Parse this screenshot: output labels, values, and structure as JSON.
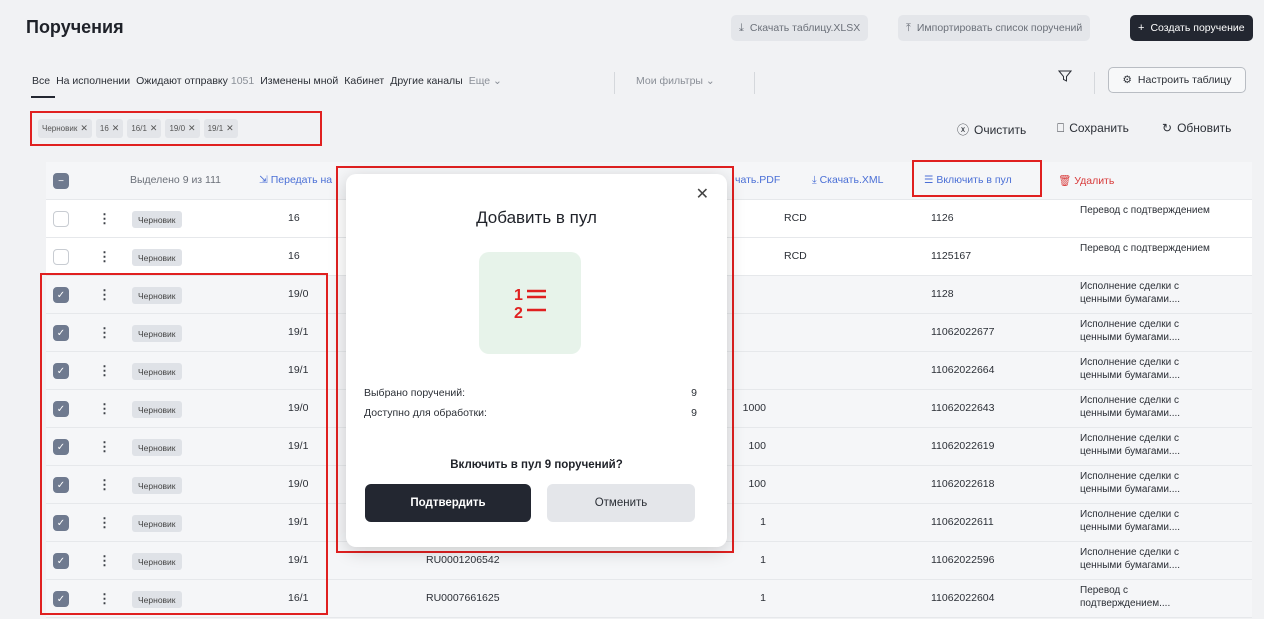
{
  "header": {
    "title": "Поручения",
    "download_xlsx": "Скачать таблицу.XLSX",
    "import_list": "Импортировать список поручений",
    "create_order": "Создать поручение"
  },
  "tabs": {
    "all": "Все",
    "in_progress": "На исполнении",
    "awaiting": "Ожидают отправку",
    "awaiting_count": "1051",
    "changed_by_me": "Изменены мной",
    "cabinet": "Кабинет",
    "other_channels": "Другие каналы",
    "more": "Еще",
    "my_filters": "Мои фильтры",
    "configure_table": "Настроить таблицу"
  },
  "chips": [
    "Черновик",
    "16",
    "16/1",
    "19/0",
    "19/1"
  ],
  "actions": {
    "clear": "Очистить",
    "save": "Сохранить",
    "refresh": "Обновить"
  },
  "table_head": {
    "selected": "Выделено 9 из 111",
    "transfer": "Передать на",
    "download_pdf": "чать.PDF",
    "download_xml": "Скачать.XML",
    "add_to_pool": "Включить в пул",
    "delete": "Удалить"
  },
  "rows": [
    {
      "checked": false,
      "status": "Черновик",
      "code": "16",
      "isin": "",
      "qty": "",
      "party": "RCD",
      "num": "1126",
      "type": "Перевод с подтверждением"
    },
    {
      "checked": false,
      "status": "Черновик",
      "code": "16",
      "isin": "",
      "qty": "",
      "party": "RCD",
      "num": "1125167",
      "type": "Перевод с подтверждением"
    },
    {
      "checked": true,
      "status": "Черновик",
      "code": "19/0",
      "isin": "",
      "qty": "",
      "party": "",
      "num": "1128",
      "type": "Исполнение сделки с ценными бумагами...."
    },
    {
      "checked": true,
      "status": "Черновик",
      "code": "19/1",
      "isin": "",
      "qty": "",
      "party": "",
      "num": "11062022677",
      "type": "Исполнение сделки с ценными бумагами...."
    },
    {
      "checked": true,
      "status": "Черновик",
      "code": "19/1",
      "isin": "",
      "qty": "",
      "party": "",
      "num": "11062022664",
      "type": "Исполнение сделки с ценными бумагами...."
    },
    {
      "checked": true,
      "status": "Черновик",
      "code": "19/0",
      "isin": "",
      "qty": "1000",
      "party": "",
      "num": "11062022643",
      "type": "Исполнение сделки с ценными бумагами...."
    },
    {
      "checked": true,
      "status": "Черновик",
      "code": "19/1",
      "isin": "",
      "qty": "100",
      "party": "",
      "num": "11062022619",
      "type": "Исполнение сделки с ценными бумагами...."
    },
    {
      "checked": true,
      "status": "Черновик",
      "code": "19/0",
      "isin": "",
      "qty": "100",
      "party": "",
      "num": "11062022618",
      "type": "Исполнение сделки с ценными бумагами...."
    },
    {
      "checked": true,
      "status": "Черновик",
      "code": "19/1",
      "isin": "",
      "qty": "1",
      "party": "",
      "num": "11062022611",
      "type": "Исполнение сделки с ценными бумагами...."
    },
    {
      "checked": true,
      "status": "Черновик",
      "code": "19/1",
      "isin": "RU0001206542",
      "qty": "1",
      "party": "",
      "num": "11062022596",
      "type": "Исполнение сделки с ценными бумагами...."
    },
    {
      "checked": true,
      "status": "Черновик",
      "code": "16/1",
      "isin": "RU0007661625",
      "qty": "1",
      "party": "",
      "num": "11062022604",
      "type": "Перевод с подтверждением...."
    }
  ],
  "modal": {
    "title": "Добавить в пул",
    "selected_label": "Выбрано поручений:",
    "selected_value": "9",
    "available_label": "Доступно для обработки:",
    "available_value": "9",
    "question": "Включить в пул 9 поручений?",
    "confirm": "Подтвердить",
    "cancel": "Отменить"
  }
}
